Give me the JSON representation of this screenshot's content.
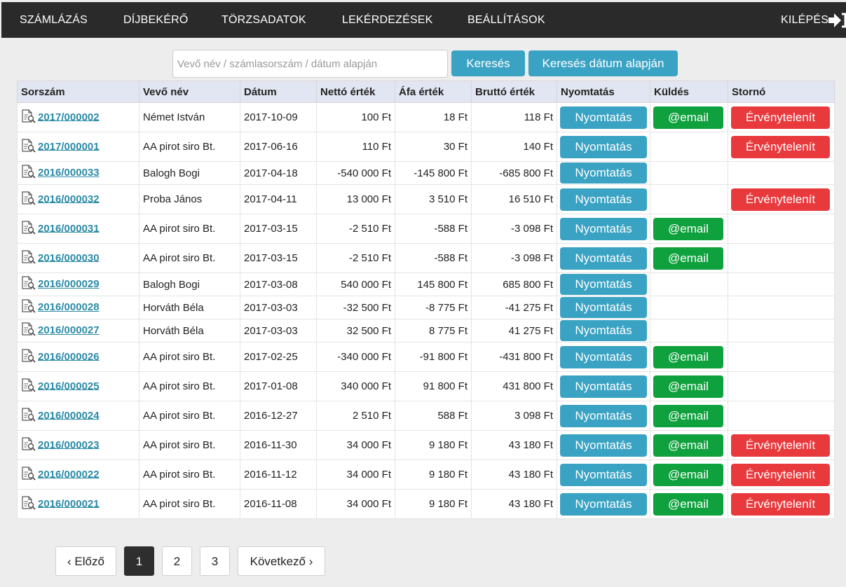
{
  "nav": {
    "items": [
      "SZÁMLÁZÁS",
      "DÍJBEKÉRŐ",
      "TÖRZSADATOK",
      "LEKÉRDEZÉSEK",
      "BEÁLLÍTÁSOK"
    ],
    "logout": "KILÉPÉS"
  },
  "search": {
    "placeholder": "Vevő név / számlasorszám / dátum alapján",
    "value": "",
    "button": "Keresés",
    "date_button": "Keresés dátum alapján"
  },
  "table": {
    "headers": [
      "Sorszám",
      "Vevő név",
      "Dátum",
      "Nettó érték",
      "Áfa érték",
      "Bruttó érték",
      "Nyomtatás",
      "Küldés",
      "Stornó"
    ],
    "print_label": "Nyomtatás",
    "email_label": "@email",
    "storno_label": "Érvénytelenít",
    "rows": [
      {
        "id": "2017/000002",
        "customer": "Német István",
        "date": "2017-10-09",
        "net": "100 Ft",
        "vat": "18 Ft",
        "gross": "118 Ft",
        "email": true,
        "storno": true
      },
      {
        "id": "2017/000001",
        "customer": "AA pirot siro Bt.",
        "date": "2017-06-16",
        "net": "110 Ft",
        "vat": "30 Ft",
        "gross": "140 Ft",
        "email": false,
        "storno": true
      },
      {
        "id": "2016/000033",
        "customer": "Balogh Bogi",
        "date": "2017-04-18",
        "net": "-540 000 Ft",
        "vat": "-145 800 Ft",
        "gross": "-685 800 Ft",
        "email": false,
        "storno": false
      },
      {
        "id": "2016/000032",
        "customer": "Proba János",
        "date": "2017-04-11",
        "net": "13 000 Ft",
        "vat": "3 510 Ft",
        "gross": "16 510 Ft",
        "email": false,
        "storno": true
      },
      {
        "id": "2016/000031",
        "customer": "AA pirot siro Bt.",
        "date": "2017-03-15",
        "net": "-2 510 Ft",
        "vat": "-588 Ft",
        "gross": "-3 098 Ft",
        "email": true,
        "storno": false
      },
      {
        "id": "2016/000030",
        "customer": "AA pirot siro Bt.",
        "date": "2017-03-15",
        "net": "-2 510 Ft",
        "vat": "-588 Ft",
        "gross": "-3 098 Ft",
        "email": true,
        "storno": false
      },
      {
        "id": "2016/000029",
        "customer": "Balogh Bogi",
        "date": "2017-03-08",
        "net": "540 000 Ft",
        "vat": "145 800 Ft",
        "gross": "685 800 Ft",
        "email": false,
        "storno": false
      },
      {
        "id": "2016/000028",
        "customer": "Horváth Béla",
        "date": "2017-03-03",
        "net": "-32 500 Ft",
        "vat": "-8 775 Ft",
        "gross": "-41 275 Ft",
        "email": false,
        "storno": false
      },
      {
        "id": "2016/000027",
        "customer": "Horváth Béla",
        "date": "2017-03-03",
        "net": "32 500 Ft",
        "vat": "8 775 Ft",
        "gross": "41 275 Ft",
        "email": false,
        "storno": false
      },
      {
        "id": "2016/000026",
        "customer": "AA pirot siro Bt.",
        "date": "2017-02-25",
        "net": "-340 000 Ft",
        "vat": "-91 800 Ft",
        "gross": "-431 800 Ft",
        "email": true,
        "storno": false
      },
      {
        "id": "2016/000025",
        "customer": "AA pirot siro Bt.",
        "date": "2017-01-08",
        "net": "340 000 Ft",
        "vat": "91 800 Ft",
        "gross": "431 800 Ft",
        "email": true,
        "storno": false
      },
      {
        "id": "2016/000024",
        "customer": "AA pirot siro Bt.",
        "date": "2016-12-27",
        "net": "2 510 Ft",
        "vat": "588 Ft",
        "gross": "3 098 Ft",
        "email": true,
        "storno": false
      },
      {
        "id": "2016/000023",
        "customer": "AA pirot siro Bt.",
        "date": "2016-11-30",
        "net": "34 000 Ft",
        "vat": "9 180 Ft",
        "gross": "43 180 Ft",
        "email": true,
        "storno": true
      },
      {
        "id": "2016/000022",
        "customer": "AA pirot siro Bt.",
        "date": "2016-11-12",
        "net": "34 000 Ft",
        "vat": "9 180 Ft",
        "gross": "43 180 Ft",
        "email": true,
        "storno": true
      },
      {
        "id": "2016/000021",
        "customer": "AA pirot siro Bt.",
        "date": "2016-11-08",
        "net": "34 000 Ft",
        "vat": "9 180 Ft",
        "gross": "43 180 Ft",
        "email": true,
        "storno": true
      }
    ]
  },
  "pagination": {
    "prev": "‹ Előző",
    "pages": [
      "1",
      "2",
      "3"
    ],
    "active": "1",
    "next": "Következő ›"
  },
  "colors": {
    "navbar": "#2a2a2a",
    "info": "#3aa3c4",
    "success": "#0fa13d",
    "danger": "#e8393c",
    "link": "#2c8ba6",
    "header_bg": "#e2e6f2"
  }
}
